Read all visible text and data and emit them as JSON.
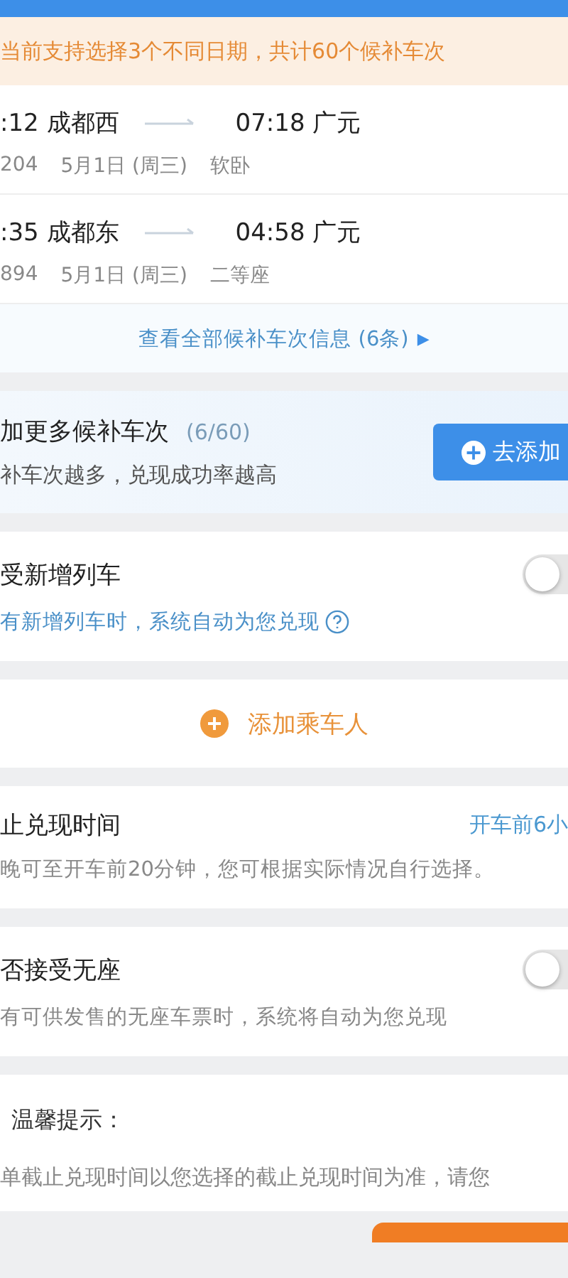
{
  "notice": "当前支持选择3个不同日期，共计60个候补车次",
  "trains": [
    {
      "depart": ":12 成都西",
      "arrive": "07:18 广元",
      "number": "204",
      "date": "5月1日 (周三)",
      "seat": "软卧"
    },
    {
      "depart": ":35 成都东",
      "arrive": "04:58 广元",
      "number": "894",
      "date": "5月1日 (周三)",
      "seat": "二等座"
    }
  ],
  "view_all_link": {
    "label": "查看全部候补车次信息 (6条)",
    "arrow": "▶"
  },
  "add_more": {
    "title": "加更多候补车次",
    "count": "(6/60)",
    "subtitle": "补车次越多，兑现成功率越高",
    "button": "去添加"
  },
  "settings": [
    {
      "kind": "toggle",
      "title": "受新增列车",
      "description": "有新增列车时，系统自动为您兑现",
      "help": true,
      "on": false
    },
    {
      "kind": "action",
      "label": "添加乘车人"
    },
    {
      "kind": "value",
      "title": "止兑现时间",
      "value": "开车前6小",
      "description": "晚可至开车前20分钟，您可根据实际情况自行选择。"
    },
    {
      "kind": "toggle",
      "title": "否接受无座",
      "description": "有可供发售的无座车票时，系统将自动为您兑现",
      "help": false,
      "on": false
    }
  ],
  "tips": {
    "title": "温馨提示：",
    "text": "单截止兑现时间以您选择的截止兑现时间为准，请您"
  }
}
